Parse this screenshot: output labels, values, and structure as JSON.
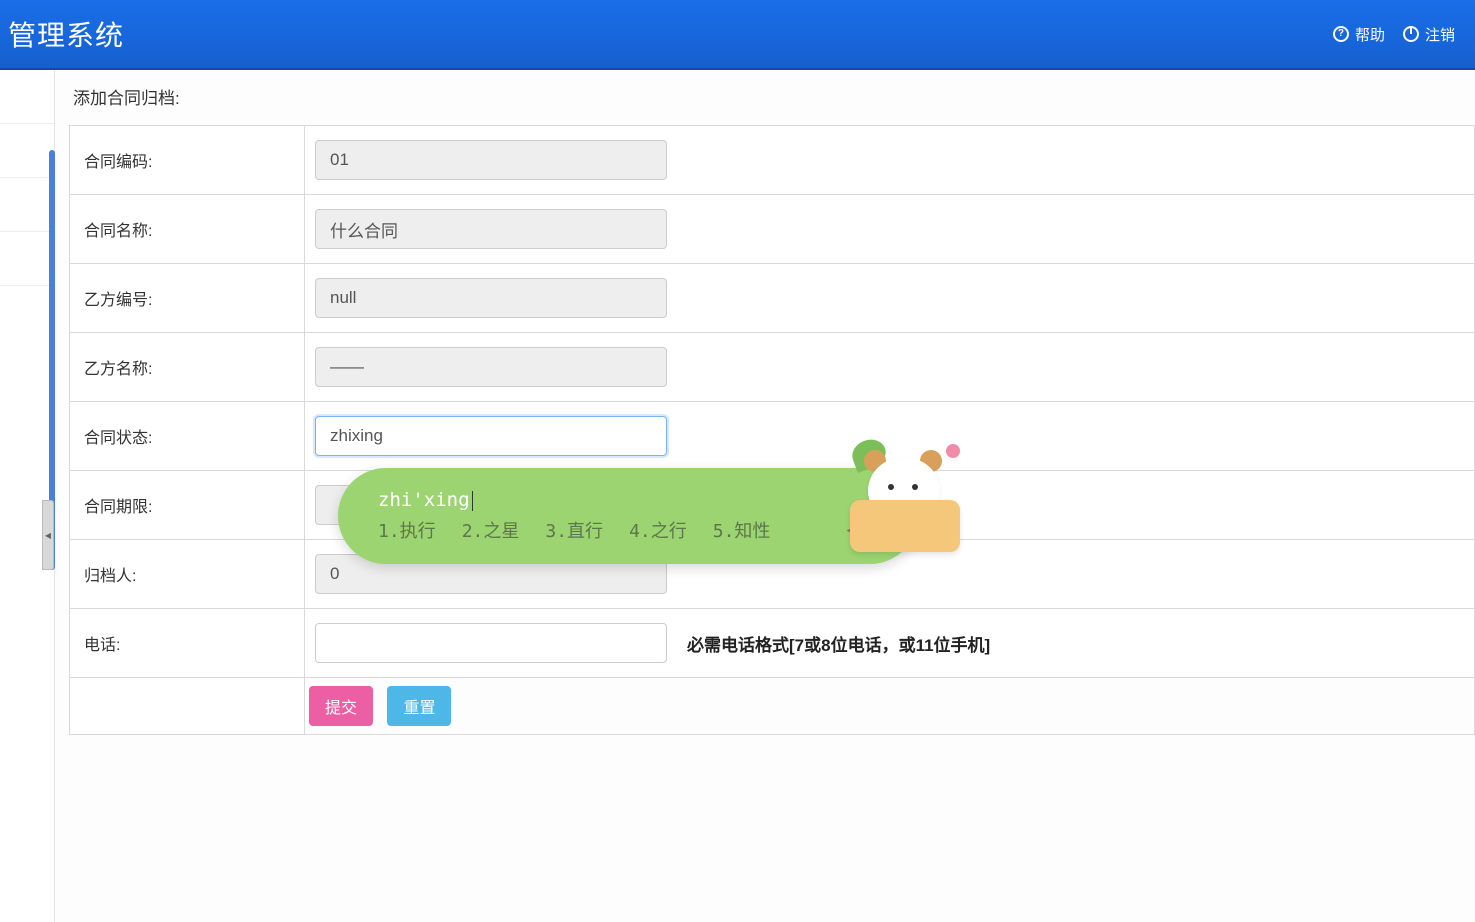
{
  "header": {
    "title": "管理系统",
    "help_label": "帮助",
    "logout_label": "注销"
  },
  "form": {
    "title": "添加合同归档:",
    "fields": {
      "contract_code": {
        "label": "合同编码:",
        "value": "01"
      },
      "contract_name": {
        "label": "合同名称:",
        "value": "什么合同"
      },
      "partyb_code": {
        "label": "乙方编号:",
        "value": "null"
      },
      "partyb_name": {
        "label": "乙方名称:",
        "value": "——"
      },
      "contract_status": {
        "label": "合同状态:",
        "value": "zhixing"
      },
      "contract_term": {
        "label": "合同期限:",
        "value": ""
      },
      "archiver": {
        "label": "归档人:",
        "value": "0"
      },
      "phone": {
        "label": "电话:",
        "value": "",
        "hint": "必需电话格式[7或8位电话，或11位手机]"
      }
    },
    "buttons": {
      "submit": "提交",
      "reset": "重置"
    }
  },
  "ime": {
    "composing": "zhi'xing",
    "candidates": [
      "1.执行",
      "2.之星",
      "3.直行",
      "4.之行",
      "5.知性"
    ]
  }
}
